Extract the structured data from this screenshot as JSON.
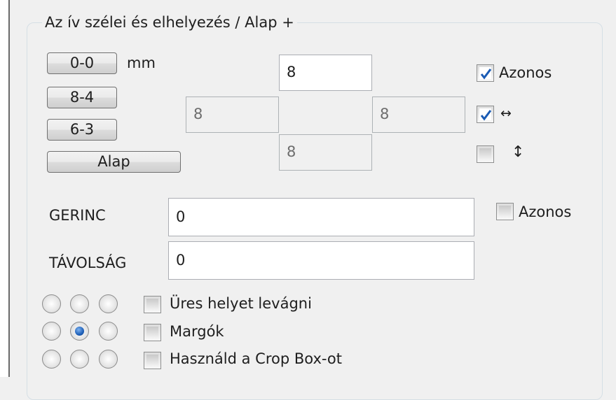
{
  "group_title": "Az ív szélei és elhelyezés / Alap +",
  "unit_label": "mm",
  "presets": [
    {
      "label": "0-0"
    },
    {
      "label": "8-4"
    },
    {
      "label": "6-3"
    },
    {
      "label": "Alap"
    }
  ],
  "margins": {
    "top": "8",
    "left": "8",
    "right": "8",
    "bottom": "8"
  },
  "checkboxes": {
    "same_all": {
      "label": "Azonos",
      "checked": true
    },
    "horizontal_same": {
      "label": "↔",
      "checked": true
    },
    "vertical_same": {
      "label": "↕",
      "checked": false
    }
  },
  "spine": {
    "label": "GERINC",
    "value": "0",
    "same_label": "Azonos",
    "same_checked": false
  },
  "distance": {
    "label": "TÁVOLSÁG",
    "value": "0"
  },
  "alignment": {
    "selected_row": 1,
    "selected_col": 1
  },
  "options": [
    {
      "label": "Üres helyet levágni",
      "checked": false
    },
    {
      "label": "Margók",
      "checked": false
    },
    {
      "label": "Használd a Crop Box-ot",
      "checked": false
    }
  ],
  "colors": {
    "check": "#1a5bb4",
    "radio_selected": "#1d5fb8"
  }
}
